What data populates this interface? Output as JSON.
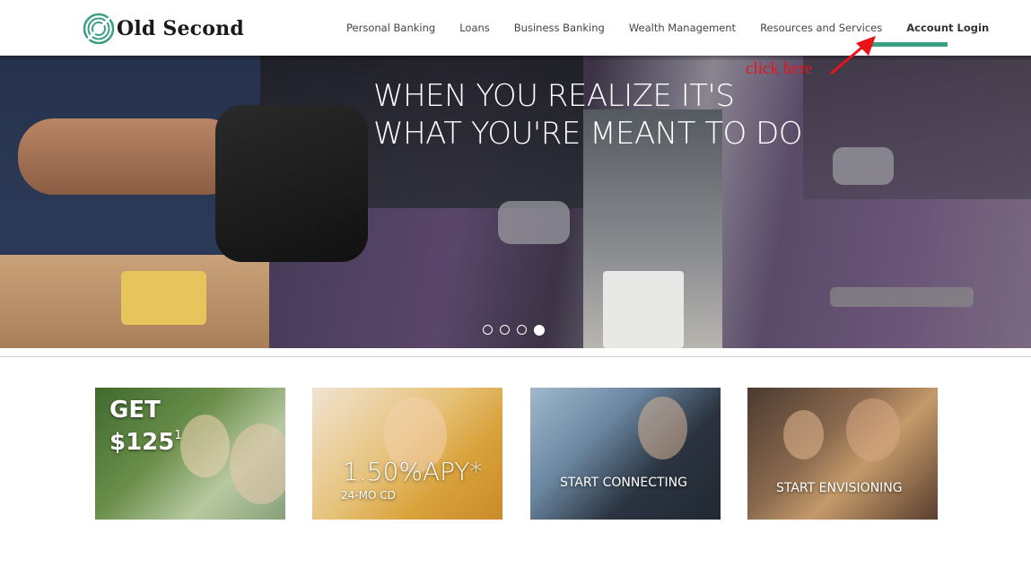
{
  "brand": {
    "name": "Old Second",
    "accent_color": "#3a9f82"
  },
  "nav": {
    "items": [
      {
        "label": "Personal Banking"
      },
      {
        "label": "Loans"
      },
      {
        "label": "Business Banking"
      },
      {
        "label": "Wealth Management"
      },
      {
        "label": "Resources and Services"
      },
      {
        "label": "Account Login"
      }
    ]
  },
  "annotation": {
    "text": "click here",
    "color": "#e8141a"
  },
  "hero": {
    "headline_line1": "WHEN YOU REALIZE IT'S",
    "headline_line2": "WHAT YOU'RE MEANT TO DO",
    "slide_count": 4,
    "active_slide": 4
  },
  "tiles": [
    {
      "line1": "GET",
      "line2": "$125",
      "footnote": "1"
    },
    {
      "line1": "1.50%APY*",
      "line2": "24-MO CD"
    },
    {
      "line1": "START CONNECTING"
    },
    {
      "line1": "START ENVISIONING"
    }
  ]
}
